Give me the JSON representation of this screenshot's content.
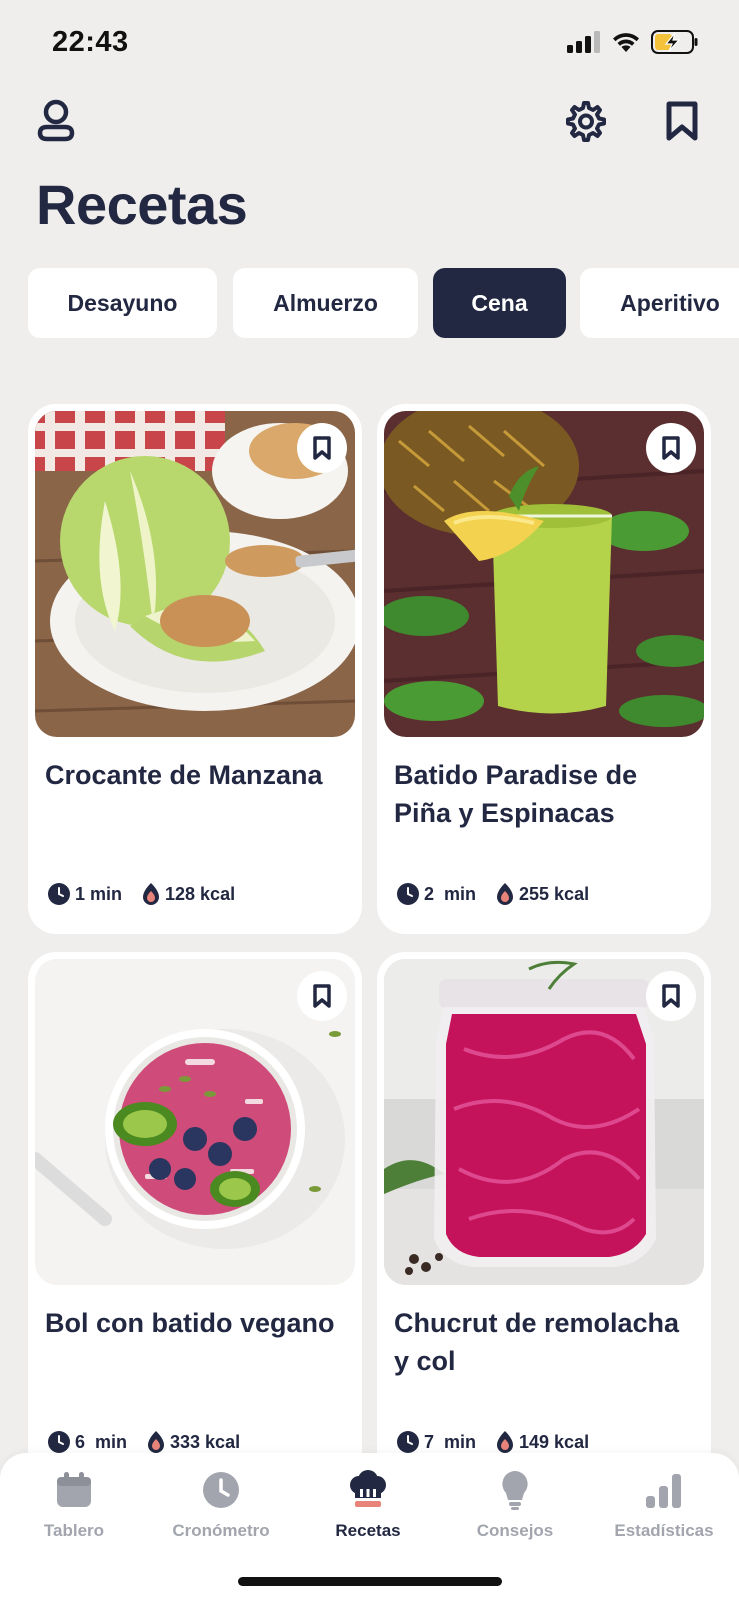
{
  "status_bar": {
    "time": "22:43"
  },
  "page_title": "Recetas",
  "tabs": [
    {
      "label": "Desayuno",
      "active": false
    },
    {
      "label": "Almuerzo",
      "active": false
    },
    {
      "label": "Cena",
      "active": true
    },
    {
      "label": "Aperitivo",
      "active": false
    }
  ],
  "recipes": [
    {
      "title": "Crocante de Manzana",
      "time": "1 min",
      "kcal": "128 kcal",
      "image": "apple-peanut-butter"
    },
    {
      "title": "Batido Paradise de Piña y Espinacas",
      "time": "2  min",
      "kcal": "255 kcal",
      "image": "pineapple-spinach-smoothie"
    },
    {
      "title": "Bol con batido vegano",
      "time": "6  min",
      "kcal": "333 kcal",
      "image": "smoothie-bowl"
    },
    {
      "title": "Chucrut de remolacha y col",
      "time": "7  min",
      "kcal": "149 kcal",
      "image": "beet-sauerkraut-jar"
    }
  ],
  "bottom_nav": [
    {
      "label": "Tablero",
      "icon": "calendar-icon",
      "active": false
    },
    {
      "label": "Cronómetro",
      "icon": "clock-icon",
      "active": false
    },
    {
      "label": "Recetas",
      "icon": "chef-hat-icon",
      "active": true
    },
    {
      "label": "Consejos",
      "icon": "lightbulb-icon",
      "active": false
    },
    {
      "label": "Estadísticas",
      "icon": "bar-chart-icon",
      "active": false
    }
  ],
  "colors": {
    "primary": "#232842",
    "background": "#efeeec",
    "accent": "#e8837a",
    "inactive": "#a3a5ae"
  }
}
